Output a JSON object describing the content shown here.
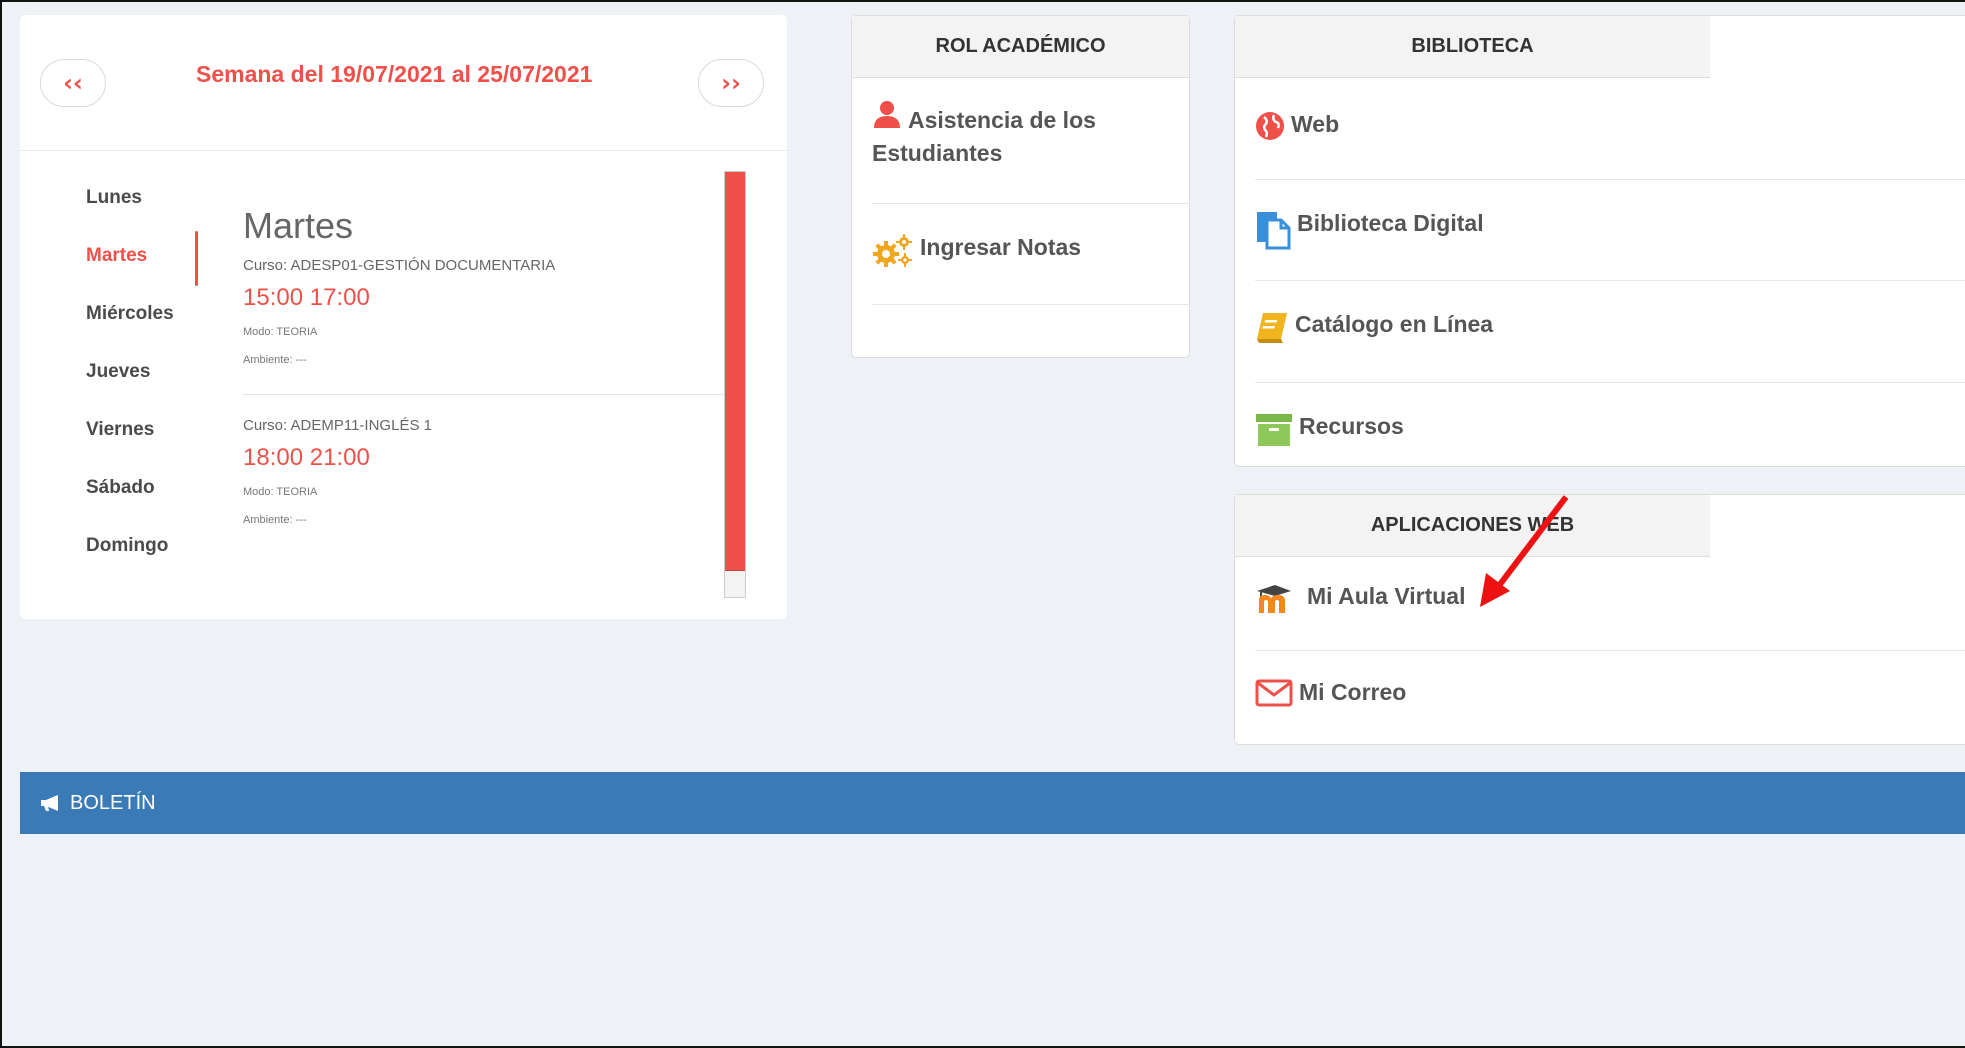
{
  "schedule": {
    "week_title": "Semana del 19/07/2021 al 25/07/2021",
    "prev_label": "‹‹",
    "next_label": "››",
    "days": [
      "Lunes",
      "Martes",
      "Miércoles",
      "Jueves",
      "Viernes",
      "Sábado",
      "Domingo"
    ],
    "active_day": "Martes",
    "detail_title": "Martes",
    "classes": [
      {
        "course": "Curso: ADESP01-GESTIÓN DOCUMENTARIA",
        "hours": "15:00 17:00",
        "mode": "Modo: TEORIA",
        "room": "Ambiente: ---"
      },
      {
        "course": "Curso: ADEMP11-INGLÉS 1",
        "hours": "18:00 21:00",
        "mode": "Modo: TEORIA",
        "room": "Ambiente: ---"
      }
    ]
  },
  "rol": {
    "title": "ROL ACADÉMICO",
    "items": [
      {
        "label": "Asistencia de los Estudiantes",
        "icon": "user-icon"
      },
      {
        "label": "Ingresar Notas",
        "icon": "gears-icon"
      }
    ]
  },
  "biblioteca": {
    "title": "BIBLIOTECA",
    "items": [
      {
        "label": "Web",
        "icon": "globe-icon"
      },
      {
        "label": "Biblioteca Digital",
        "icon": "document-icon"
      },
      {
        "label": "Catálogo en Línea",
        "icon": "book-icon"
      },
      {
        "label": "Recursos",
        "icon": "archive-icon"
      }
    ]
  },
  "aplicaciones": {
    "title": "APLICACIONES WEB",
    "items": [
      {
        "label": "Mi Aula Virtual",
        "icon": "moodle-icon"
      },
      {
        "label": "Mi Correo",
        "icon": "envelope-icon"
      }
    ]
  },
  "bulletin": {
    "label": "BOLETÍN",
    "icon": "megaphone-icon"
  },
  "colors": {
    "accent": "#f0504a",
    "bulletin_bg": "#3a7ab6",
    "panel_head": "#f3f3f3"
  }
}
